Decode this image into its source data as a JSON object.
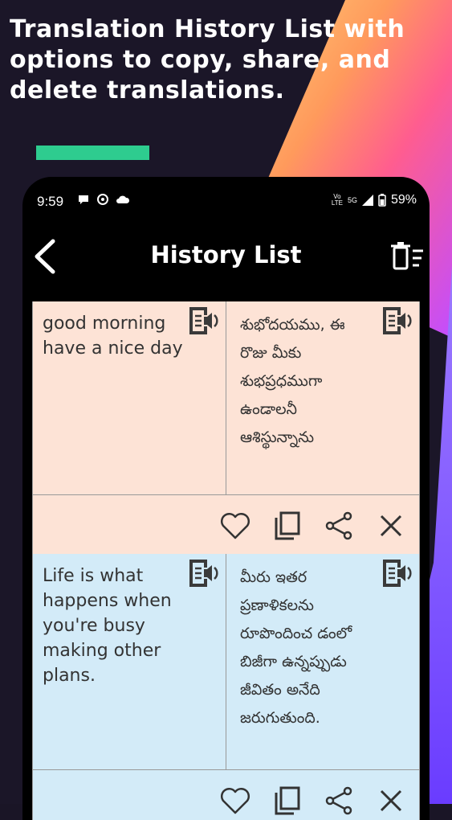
{
  "headline": "Translation History List with options to copy, share, and delete translations.",
  "colors": {
    "accent": "#2ecc8f",
    "card1_bg": "#fde3d6",
    "card2_bg": "#d3ebf8"
  },
  "status": {
    "time": "9:59",
    "volte_top": "Vo",
    "volte_bottom": "LTE",
    "network": "5G",
    "battery": "59%"
  },
  "appbar": {
    "title": "History List",
    "back_icon": "back-arrow-icon",
    "trash_icon": "delete-all-icon"
  },
  "history": [
    {
      "source": "good morning have a nice day",
      "target": "శుభోదయము, ఈ రొజు మీకు శుభప్రధముగా ఉండాలనీ ఆశిస్థున్నాను"
    },
    {
      "source": "Life is what happens when you're busy making other plans.",
      "target": "మీరు ఇతర ప్రణాళికలను రూపొందించ డంలో బిజీగా ఉన్నప్పుడు జీవితం అనేది జరుగుతుంది."
    }
  ],
  "icons": [
    "speaker-icon",
    "favorite-icon",
    "copy-icon",
    "share-icon",
    "close-icon"
  ]
}
